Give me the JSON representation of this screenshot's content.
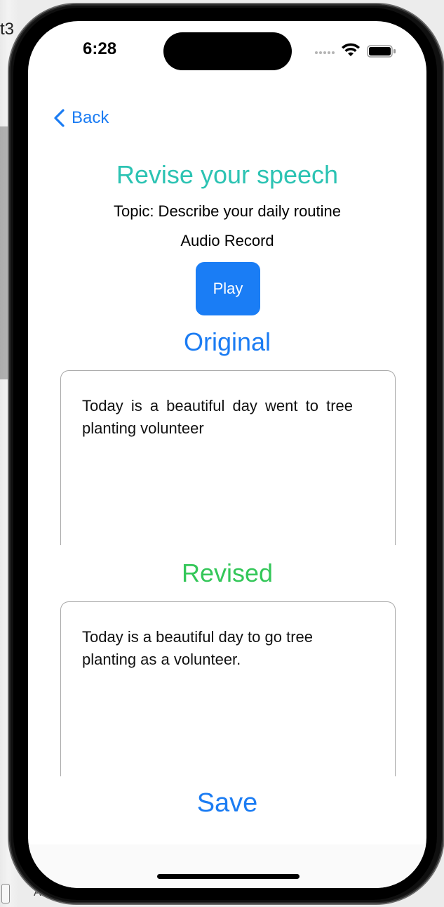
{
  "host": {
    "edge_text": "t3",
    "bottom_text": "Auto"
  },
  "status_bar": {
    "time": "6:28"
  },
  "nav": {
    "back_label": "Back"
  },
  "page": {
    "title": "Revise your speech",
    "topic": "Topic: Describe your daily routine",
    "audio_label": "Audio Record",
    "play_label": "Play"
  },
  "original": {
    "heading": "Original",
    "text": "Today is a beautiful day went to tree planting volunteer"
  },
  "revised": {
    "heading": "Revised",
    "text": "Today is a beautiful day to go tree planting as a volunteer."
  },
  "actions": {
    "save_label": "Save"
  },
  "colors": {
    "title": "#2cc3b3",
    "accent": "#1b7cf3",
    "revised": "#34c759",
    "play_bg": "#1a7df5"
  },
  "icons": {
    "back": "chevron-left-icon",
    "wifi": "wifi-icon",
    "battery": "battery-icon",
    "signal": "signal-dots-icon"
  }
}
